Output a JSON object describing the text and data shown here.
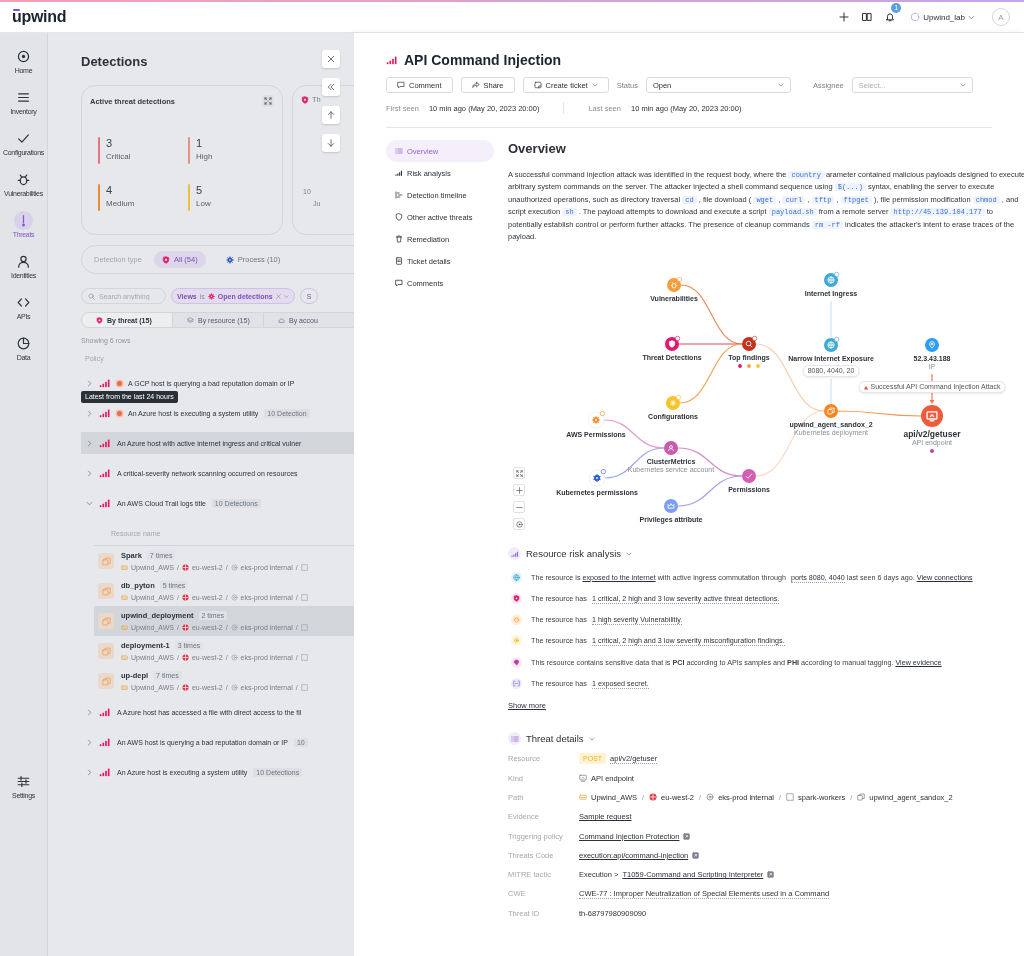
{
  "topbar": {
    "logo": "upwind",
    "notification_count": "1",
    "workspace": "Upwind_lab",
    "avatar": "A"
  },
  "nav": {
    "items": [
      {
        "label": "Home",
        "selected": false
      },
      {
        "label": "Inventory",
        "selected": false
      },
      {
        "label": "Configurations",
        "selected": false
      },
      {
        "label": "Vulnerabilities",
        "selected": false
      },
      {
        "label": "Threats",
        "selected": true
      },
      {
        "label": "Identities",
        "selected": false
      },
      {
        "label": "APIs",
        "selected": false
      },
      {
        "label": "Data",
        "selected": false
      }
    ],
    "settings": {
      "label": "Settings"
    }
  },
  "detections": {
    "title": "Detections",
    "summary": {
      "title": "Active threat detections",
      "stats": [
        {
          "value": "3",
          "label": "Critical",
          "color": "#e8737f"
        },
        {
          "value": "1",
          "label": "High",
          "color": "#e9907f"
        },
        {
          "value": "4",
          "label": "Medium",
          "color": "#f08a30"
        },
        {
          "value": "5",
          "label": "Low",
          "color": "#e8c23f"
        }
      ]
    },
    "trend_card": {
      "title": "Th",
      "tick": "10",
      "x_label": "Ju"
    },
    "detection_type": {
      "label": "Detection type",
      "chips": [
        {
          "label": "All (54)",
          "selected": true
        },
        {
          "label": "Process (10)",
          "selected": false
        }
      ]
    },
    "search": {
      "placeholder": "Search anything"
    },
    "filter": {
      "field": "Views",
      "operator": "is",
      "value": "Open detections"
    },
    "filter_cut": "S",
    "tabs": [
      {
        "label": "By threat (15)",
        "selected": true
      },
      {
        "label": "By resource (15)",
        "selected": false
      },
      {
        "label": "By accou",
        "selected": false
      }
    ],
    "row_count": "Showing 6 rows",
    "column": "Policy",
    "tooltip": "Latest from the last 24 hours",
    "path_separator": "/",
    "policies": [
      {
        "title": "A GCP host is querying a bad reputation domain or IP",
        "new": true,
        "expanded": false,
        "highlighted": false
      },
      {
        "title": "An Azure host is executing a system utility",
        "new": true,
        "badge": "10 Detection",
        "expanded": false,
        "highlighted": false
      },
      {
        "title": "An Azure host with active internet ingress and critical vulner",
        "new": false,
        "expanded": false,
        "highlighted": true
      },
      {
        "title": "A critical-severity network scanning occurred on resources",
        "new": false,
        "expanded": false,
        "highlighted": false
      },
      {
        "title": "An AWS Cloud Trail logs title",
        "new": false,
        "badge": "10 Detections",
        "expanded": true,
        "highlighted": false,
        "resources_header": "Resource name",
        "resources": [
          {
            "name": "Spark",
            "count": "7 times",
            "path": [
              "Upwind_AWS",
              "eu-west-2",
              "eks-prod internal"
            ],
            "highlighted": false
          },
          {
            "name": "db_pyton",
            "count": "5 times",
            "path": [
              "Upwind_AWS",
              "eu-west-2",
              "eks-prod internal"
            ],
            "highlighted": false
          },
          {
            "name": "upwind_deployment",
            "count": "2 times",
            "path": [
              "Upwind_AWS",
              "eu-west-2",
              "eks-prod internal"
            ],
            "highlighted": true
          },
          {
            "name": "deployment-1",
            "count": "3 times",
            "path": [
              "Upwind_AWS",
              "eu-west-2",
              "eks-prod internal"
            ],
            "highlighted": false
          },
          {
            "name": "up-depl",
            "count": "7 times",
            "path": [
              "Upwind_AWS",
              "eu-west-2",
              "eks-prod internal"
            ],
            "highlighted": false
          }
        ]
      },
      {
        "title": "A Azure host has accessed a file with direct access to the fil",
        "new": false,
        "expanded": false,
        "highlighted": false
      },
      {
        "title": "An AWS host is querying a bad reputation domain or IP",
        "new": false,
        "badge": "10",
        "expanded": false,
        "highlighted": false
      },
      {
        "title": "An Azure host is executing a system utility",
        "new": false,
        "badge": "10 Detections",
        "expanded": false,
        "highlighted": false
      }
    ]
  },
  "drawer": {
    "title": "API Command Injection",
    "actions": [
      {
        "label": "Comment",
        "dropdown": false
      },
      {
        "label": "Share",
        "dropdown": false
      },
      {
        "label": "Create ticket",
        "dropdown": true
      }
    ],
    "status": {
      "label": "Status",
      "value": "Open"
    },
    "assignee": {
      "label": "Assignee",
      "placeholder": "Select..."
    },
    "first_seen": {
      "label": "First seen",
      "value": "10 min ago (May 20, 2023 20:00)"
    },
    "last_seen": {
      "label": "Last seen",
      "value": "10 min ago (May 20, 2023 20:00)"
    },
    "sections_nav": [
      {
        "label": "Overview",
        "selected": true
      },
      {
        "label": "Risk analysis",
        "selected": false
      },
      {
        "label": "Detection timeline",
        "selected": false
      },
      {
        "label": "Other active threats",
        "selected": false
      },
      {
        "label": "Remediation",
        "selected": false
      },
      {
        "label": "Ticket details",
        "selected": false
      },
      {
        "label": "Comments",
        "selected": false
      }
    ],
    "overview": {
      "title": "Overview",
      "description": [
        {
          "kind": "text",
          "text": "A successful command injection attack was identified in the request body, where the "
        },
        {
          "kind": "code",
          "text": "country"
        },
        {
          "kind": "text",
          "text": " arameter contained malicious payloads designed to execute arbitrary system commands on the server. The attacker injected a shell command sequence using "
        },
        {
          "kind": "code",
          "text": "$(...)"
        },
        {
          "kind": "text",
          "text": " syntax, enabling the server to execute unauthorized operations, such as directory traversal "
        },
        {
          "kind": "code",
          "text": "cd"
        },
        {
          "kind": "text",
          "text": " , file download ( "
        },
        {
          "kind": "code",
          "text": "wget"
        },
        {
          "kind": "text",
          "text": " , "
        },
        {
          "kind": "code",
          "text": "curl"
        },
        {
          "kind": "text",
          "text": " , "
        },
        {
          "kind": "code",
          "text": "tftp"
        },
        {
          "kind": "text",
          "text": " , "
        },
        {
          "kind": "code",
          "text": "ftpget"
        },
        {
          "kind": "text",
          "text": " ), file permission modification "
        },
        {
          "kind": "code",
          "text": "chmod"
        },
        {
          "kind": "text",
          "text": " , and script execution "
        },
        {
          "kind": "code",
          "text": "sh"
        },
        {
          "kind": "text",
          "text": " . The payload attempts to download and execute a script "
        },
        {
          "kind": "code",
          "text": "payload.sh"
        },
        {
          "kind": "text",
          "text": " from a remote server "
        },
        {
          "kind": "code",
          "text": "http://45.139.104.177"
        },
        {
          "kind": "text",
          "text": " to potentially establish control or perform further attacks. The presence of cleanup commands "
        },
        {
          "kind": "code",
          "text": "rm -rf"
        },
        {
          "kind": "text",
          "text": " indicates the attacker's intent to erase traces of the payload."
        }
      ]
    },
    "graph": {
      "alert": "Successful API Command Injection Attack",
      "nodes": [
        {
          "label": "Vulnerabilities",
          "kind": "bug",
          "color": "#f59e3b",
          "badge": true
        },
        {
          "label": "Internet Ingress",
          "kind": "globe",
          "color": "#3fa9d6",
          "badge": true
        },
        {
          "label": "Threat Detections",
          "kind": "shield",
          "color": "#e3176c",
          "badge": true
        },
        {
          "label": "Top findings",
          "kind": "findings",
          "color": "#c6301f",
          "badge": true
        },
        {
          "label": "Narrow Internet Exposure",
          "kind": "globe",
          "color": "#3fa9d6",
          "badge": true,
          "ports": "8080, 4040, 20"
        },
        {
          "label": "52.3.43.188",
          "sublabel": "IP",
          "kind": "pin",
          "color": "#2f9ef2",
          "badge": false
        },
        {
          "label": "AWS Permissions",
          "kind": "aws",
          "color": "#f08a24",
          "badge": true
        },
        {
          "label": "Configurations",
          "kind": "config",
          "color": "#f7c22b",
          "badge": true
        },
        {
          "label": "upwind_agent_sandox_2",
          "sublabel": "Kubernetes deployment",
          "kind": "deployment",
          "color": "#f7841e",
          "badge": false
        },
        {
          "label": "api/v2/getuser",
          "sublabel": "API endpoint",
          "kind": "endpoint",
          "color": "#ef5a3b",
          "badge": false
        },
        {
          "label": "ClusterMetrics",
          "sublabel": "Kubernetes service account",
          "kind": "account",
          "color": "#c95aae",
          "badge": false
        },
        {
          "label": "Kubernetes permissions",
          "kind": "kubernetes",
          "color": "#2b5be0",
          "badge": true
        },
        {
          "label": "Permissions",
          "kind": "check",
          "color": "#d35eb2",
          "badge": false
        },
        {
          "label": "Privileges attribute",
          "kind": "crown",
          "color": "#7d9ef6",
          "badge": false
        }
      ]
    },
    "risk": {
      "title": "Resource risk analysis",
      "show_more": "Show more",
      "items": [
        {
          "kind": "internet",
          "parts": [
            {
              "kind": "text",
              "text": "The resource is "
            },
            {
              "kind": "link",
              "text": "exposed to the internet"
            },
            {
              "kind": "text",
              "text": " with active ingress commutation through "
            },
            {
              "kind": "dotted",
              "text": "ports 8080, 4040"
            },
            {
              "kind": "text",
              "text": " last seen 6 days ago. "
            },
            {
              "kind": "link",
              "text": "View connections"
            }
          ]
        },
        {
          "kind": "threat",
          "parts": [
            {
              "kind": "text",
              "text": "The resource has "
            },
            {
              "kind": "dotted",
              "text": "1 critical,  2 high and 3 low severity active threat detections."
            }
          ]
        },
        {
          "kind": "vulnerability",
          "parts": [
            {
              "kind": "text",
              "text": "The resource has "
            },
            {
              "kind": "dotted",
              "text": "1 high severity Vulnerabilitiy."
            }
          ]
        },
        {
          "kind": "misconfiguration",
          "parts": [
            {
              "kind": "text",
              "text": "The resource has "
            },
            {
              "kind": "dotted",
              "text": "1 critical,  2 high and 3 low severity misconfiguration findings."
            }
          ]
        },
        {
          "kind": "data",
          "parts": [
            {
              "kind": "text",
              "text": "This resource contains sensitive data that is **PCI** according to APIs samples and **PHI** according to manual tagging. "
            },
            {
              "kind": "link",
              "text": "View evidence"
            }
          ]
        },
        {
          "kind": "secret",
          "parts": [
            {
              "kind": "text",
              "text": "The resource has "
            },
            {
              "kind": "dotted",
              "text": "1 exposed secret."
            }
          ]
        }
      ]
    },
    "threat_details": {
      "title": "Threat details",
      "path_separator": "/",
      "rows": [
        {
          "label": "Resource",
          "kind": "resource",
          "method": "POST",
          "value": "api/v2/getuser"
        },
        {
          "label": "Kind",
          "kind": "kind",
          "value": "API endpoint"
        },
        {
          "label": "Path",
          "kind": "path",
          "segments": [
            "Upwind_AWS",
            "eu-west-2",
            "eks-prod internal",
            "spark-workers",
            "upwind_agent_sandox_2"
          ]
        },
        {
          "label": "Evidence",
          "kind": "link",
          "value": "Sample request"
        },
        {
          "label": "Triggering policy",
          "kind": "external_link",
          "value": "Command Injection Protection"
        },
        {
          "label": "Threats Code",
          "kind": "external_link",
          "value": "execution:api/command-injection"
        },
        {
          "label": "MITRE tactic",
          "kind": "tactic",
          "prefix": "Execution >",
          "value": "T1059-Command and Scripting Interpreter"
        },
        {
          "label": "CWE",
          "kind": "dotted",
          "value": "CWE-77 : Improper Neutralization of Special Elements used in a Command"
        },
        {
          "label": "Threat ID",
          "kind": "plain",
          "value": "th-68797980909090"
        }
      ]
    }
  }
}
